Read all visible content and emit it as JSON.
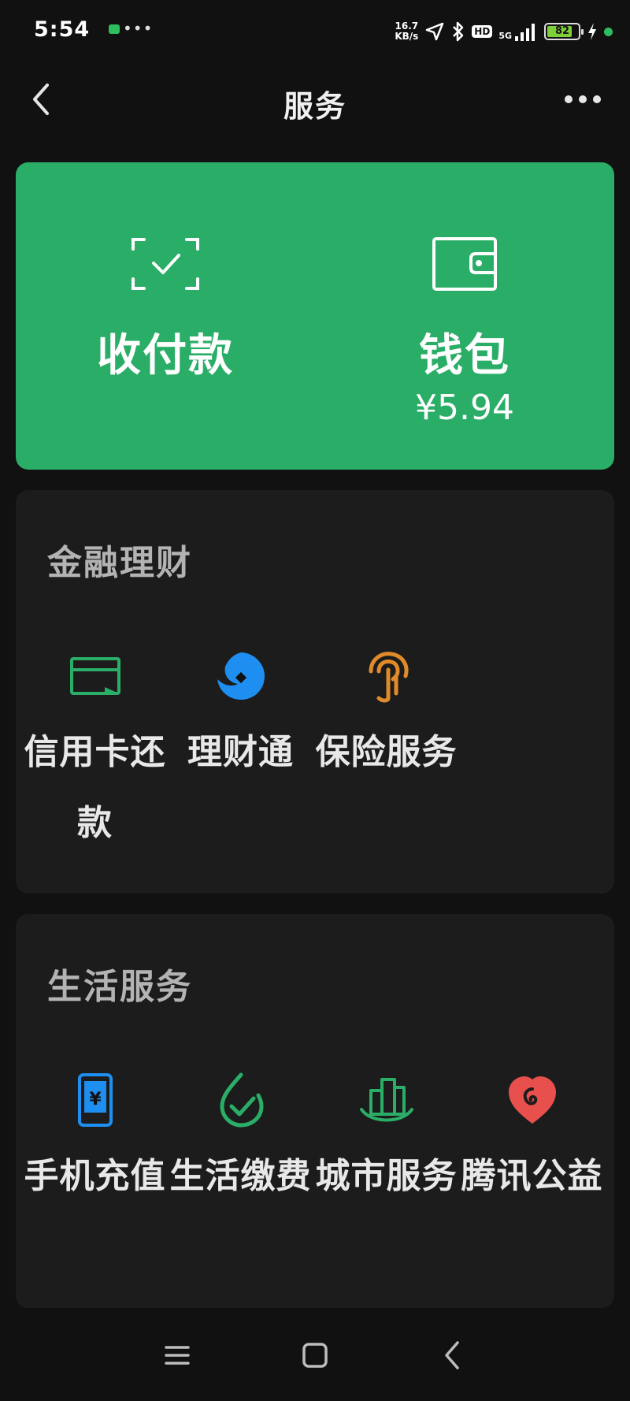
{
  "status_bar": {
    "time": "5:54",
    "notif_dots": "•••",
    "net_speed_value": "16.7",
    "net_speed_unit": "KB/s",
    "hd": "HD",
    "network": "5G",
    "battery_level": "82",
    "battery_fraction": 0.82
  },
  "header": {
    "title": "服务"
  },
  "pay_card": {
    "background": "#2aae67",
    "pay": {
      "label": "收付款",
      "icon": "scan-check-icon"
    },
    "wallet": {
      "label": "钱包",
      "amount": "¥5.94",
      "icon": "wallet-icon"
    }
  },
  "sections": {
    "finance": {
      "title": "金融理财",
      "items": [
        {
          "label": "信用卡还款",
          "icon": "credit-card-icon",
          "color": "#2aae67"
        },
        {
          "label": "理财通",
          "icon": "licaitong-icon",
          "color": "#1e8ff0"
        },
        {
          "label": "保险服务",
          "icon": "insurance-icon",
          "color": "#e08a2a"
        }
      ]
    },
    "life": {
      "title": "生活服务",
      "items": [
        {
          "label": "手机充值",
          "icon": "phone-recharge-icon",
          "color": "#1e8ff0"
        },
        {
          "label": "生活缴费",
          "icon": "utility-payment-icon",
          "color": "#2aae67"
        },
        {
          "label": "城市服务",
          "icon": "city-service-icon",
          "color": "#2aae67"
        },
        {
          "label": "腾讯公益",
          "icon": "charity-heart-icon",
          "color": "#e8504e"
        }
      ]
    }
  },
  "nav_bar": {
    "menu_icon": "menu-icon",
    "home_icon": "home-square-icon",
    "back_icon": "back-triangle-icon"
  }
}
